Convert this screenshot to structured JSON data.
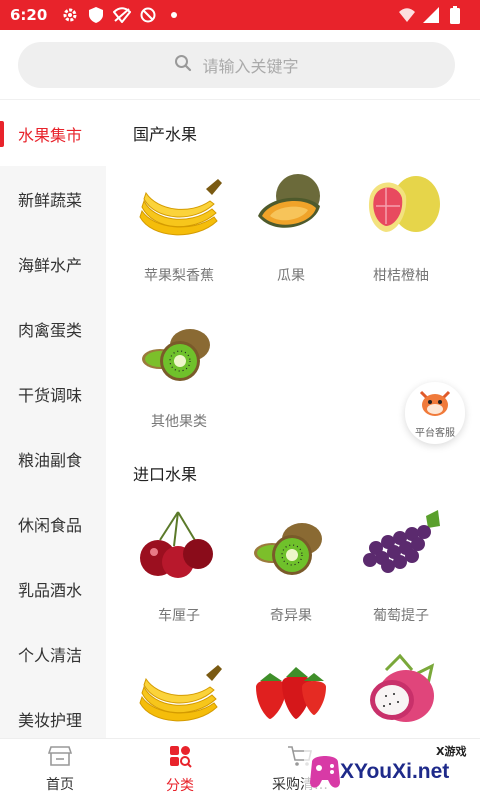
{
  "status_bar": {
    "time": "6:20"
  },
  "search": {
    "placeholder": "请输入关键字"
  },
  "sidebar": {
    "items": [
      {
        "label": "水果集市"
      },
      {
        "label": "新鲜蔬菜"
      },
      {
        "label": "海鲜水产"
      },
      {
        "label": "肉禽蛋类"
      },
      {
        "label": "干货调味"
      },
      {
        "label": "粮油副食"
      },
      {
        "label": "休闲食品"
      },
      {
        "label": "乳品酒水"
      },
      {
        "label": "个人清洁"
      },
      {
        "label": "美妆护理"
      }
    ]
  },
  "sections": [
    {
      "title": "国产水果",
      "products": [
        {
          "name": "苹果梨香蕉",
          "icon": "banana-image"
        },
        {
          "name": "瓜果",
          "icon": "melon-image"
        },
        {
          "name": "柑桔橙柚",
          "icon": "pomelo-image"
        },
        {
          "name": "其他果类",
          "icon": "kiwi-image"
        }
      ]
    },
    {
      "title": "进口水果",
      "products": [
        {
          "name": "车厘子",
          "icon": "cherry-image"
        },
        {
          "name": "奇异果",
          "icon": "kiwi-image"
        },
        {
          "name": "葡萄提子",
          "icon": "grape-image"
        },
        {
          "name": "",
          "icon": "banana-image"
        },
        {
          "name": "",
          "icon": "strawberry-image"
        },
        {
          "name": "",
          "icon": "dragonfruit-image"
        }
      ]
    }
  ],
  "float_service": {
    "label": "平台客服"
  },
  "tabbar": {
    "items": [
      {
        "label": "首页"
      },
      {
        "label": "分类"
      },
      {
        "label": "采购清…"
      }
    ]
  },
  "watermark": {
    "small": "X游戏",
    "big": "XYouXi.net"
  },
  "colors": {
    "accent": "#e8232b",
    "sidebar_bg": "#f6f6f6",
    "search_bg": "#efefef"
  }
}
